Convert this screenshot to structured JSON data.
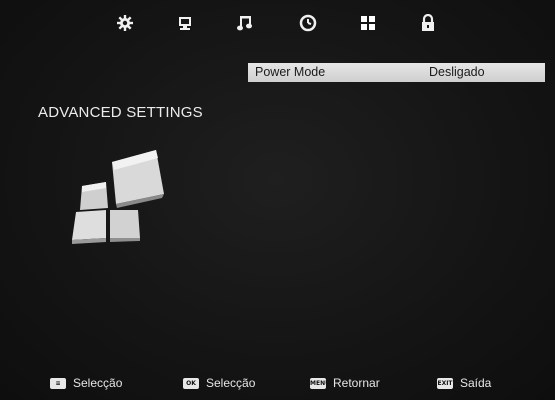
{
  "top_menu": {
    "items": [
      {
        "name": "picture",
        "icon": "settings-gear-icon"
      },
      {
        "name": "sound-display",
        "icon": "monitor-icon"
      },
      {
        "name": "music",
        "icon": "music-note-icon"
      },
      {
        "name": "timer",
        "icon": "clock-icon"
      },
      {
        "name": "advanced",
        "icon": "grid-icon"
      },
      {
        "name": "lock",
        "icon": "lock-icon"
      }
    ]
  },
  "settings": {
    "rows": [
      {
        "label": "Power Mode",
        "value": "Desligado"
      }
    ]
  },
  "page": {
    "title": "ADVANCED SETTINGS"
  },
  "footer": {
    "hints": [
      {
        "key": "≡",
        "label": "Selecção"
      },
      {
        "key": "OK",
        "label": "Selecção"
      },
      {
        "key": "MENU",
        "label": "Retornar"
      },
      {
        "key": "EXIT",
        "label": "Saída"
      }
    ]
  },
  "colors": {
    "background": "#161616",
    "highlight_bar": "#dcdcdc",
    "text": "#ececec"
  }
}
